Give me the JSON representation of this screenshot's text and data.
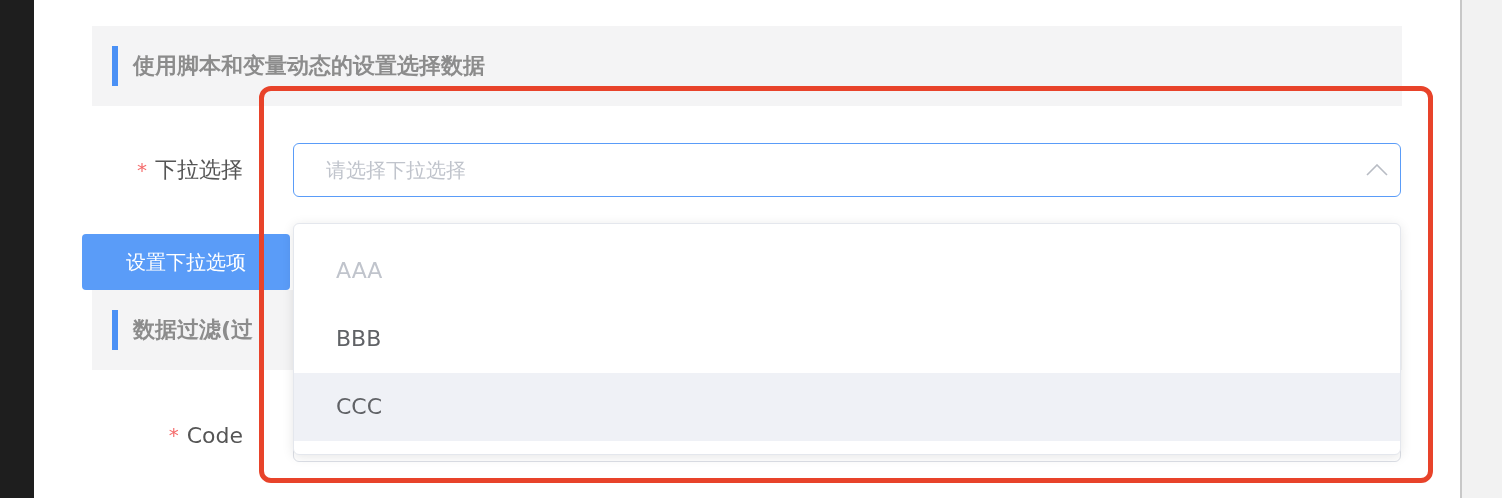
{
  "section_1": {
    "title": "使用脚本和变量动态的设置选择数据"
  },
  "select_field": {
    "required_mark": "*",
    "label": "下拉选择",
    "placeholder": "请选择下拉选择",
    "expanded": true
  },
  "dropdown": {
    "options": [
      {
        "label": "AAA",
        "disabled": true,
        "highlighted": false
      },
      {
        "label": "BBB",
        "disabled": false,
        "highlighted": false
      },
      {
        "label": "CCC",
        "disabled": false,
        "highlighted": true
      }
    ]
  },
  "button": {
    "label": "设置下拉选项"
  },
  "section_2": {
    "title": "数据过滤(过"
  },
  "code_field": {
    "required_mark": "*",
    "label": "Code"
  }
}
